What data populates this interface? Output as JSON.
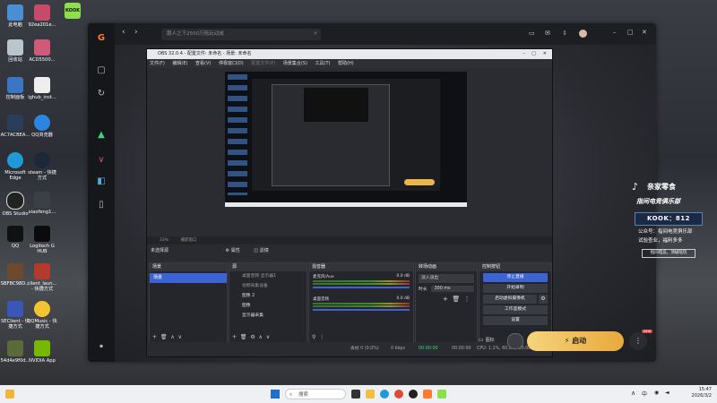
{
  "desktop": {
    "col1": [
      "此电脑",
      "回收站",
      "控制面板",
      "AC7ACBEA...",
      "Microsoft Edge",
      "OBS Studio",
      "QQ",
      "SBFBC98D...",
      "SEClient - 快捷方式",
      "54d4e9f0d..."
    ],
    "col2": [
      "92ea201e...",
      "ACD5500...",
      "lghub_inst...",
      "QQ浏览器",
      "steam - 快捷方式",
      "xiaofeng1...",
      "Logitech G HUB",
      "client_laun... - 快捷方式",
      "QQMusic - 快捷方式",
      "NVIDIA App"
    ],
    "kook_tile": "KOOK"
  },
  "app": {
    "search_placeholder": "跟人之下2500万陪玩动减",
    "rail_icons": [
      "logo-icon",
      "bag-icon",
      "refresh-icon",
      "triangle-icon",
      "v-icon",
      "l-icon",
      "phone-icon"
    ],
    "top_icons": [
      "chat-icon",
      "mail-icon",
      "download-icon",
      "avatar",
      "minimize-icon",
      "maximize-icon",
      "close-icon"
    ],
    "badge": "亲家零食",
    "banner": "指间电竞俱乐部",
    "kook_id": "KOOK：812",
    "line1": "公众号：指间电竞俱乐部",
    "line2": "试验查业，福利多多",
    "small_badge": "指间电竞，顶级陪玩",
    "bottom_label": "图标",
    "start_label": "启动",
    "new_badge": "NEW"
  },
  "obs": {
    "title": "OBS 32.0.4 - 配置文件: 未命名 - 场景: 未命名",
    "menu": [
      "文件(F)",
      "编辑(E)",
      "查看(V)",
      "停靠窗口(D)",
      "配置文件(P)",
      "场景集合(S)",
      "工具(T)",
      "帮助(H)"
    ],
    "zoom": "33%",
    "preview_label": "捕获窗口",
    "no_source": "未选择源",
    "props_label": "属性",
    "filters_label": "滤镜",
    "docks": {
      "scenes": {
        "title": "场景",
        "items": [
          "场景"
        ]
      },
      "sources": {
        "title": "源",
        "items": [
          "桌面音频 显示器1",
          "视频采集设备",
          "图像 2",
          "图像",
          "显示器采集"
        ]
      },
      "mixer": {
        "title": "混音器",
        "ch1": "麦克风/Aux",
        "ch1_db": "0.0 dB",
        "ch2": "桌面音频",
        "ch2_db": "0.0 dB"
      },
      "transitions": {
        "title": "转场动画",
        "mode": "淡入淡出",
        "duration_label": "时长",
        "duration": "300 ms"
      },
      "controls": {
        "title": "控制按钮",
        "buttons": [
          "停止直播",
          "开始录制",
          "启动虚拟摄像机",
          "工作室模式",
          "设置"
        ]
      }
    },
    "footer": {
      "frames": "丢帧 0 (0.0%)",
      "kbps": "0 kbps",
      "rec": "00:00:00",
      "stream": "00:00:00",
      "cpu": "CPU: 1.1%, 60.00 / 60.00 FPS"
    }
  },
  "taskbar": {
    "search": "搜索",
    "lang": "中",
    "time": "15:47",
    "date": "2026/3/2"
  },
  "colors": {
    "accent": "#3c63d6",
    "start": "#f0c050"
  }
}
